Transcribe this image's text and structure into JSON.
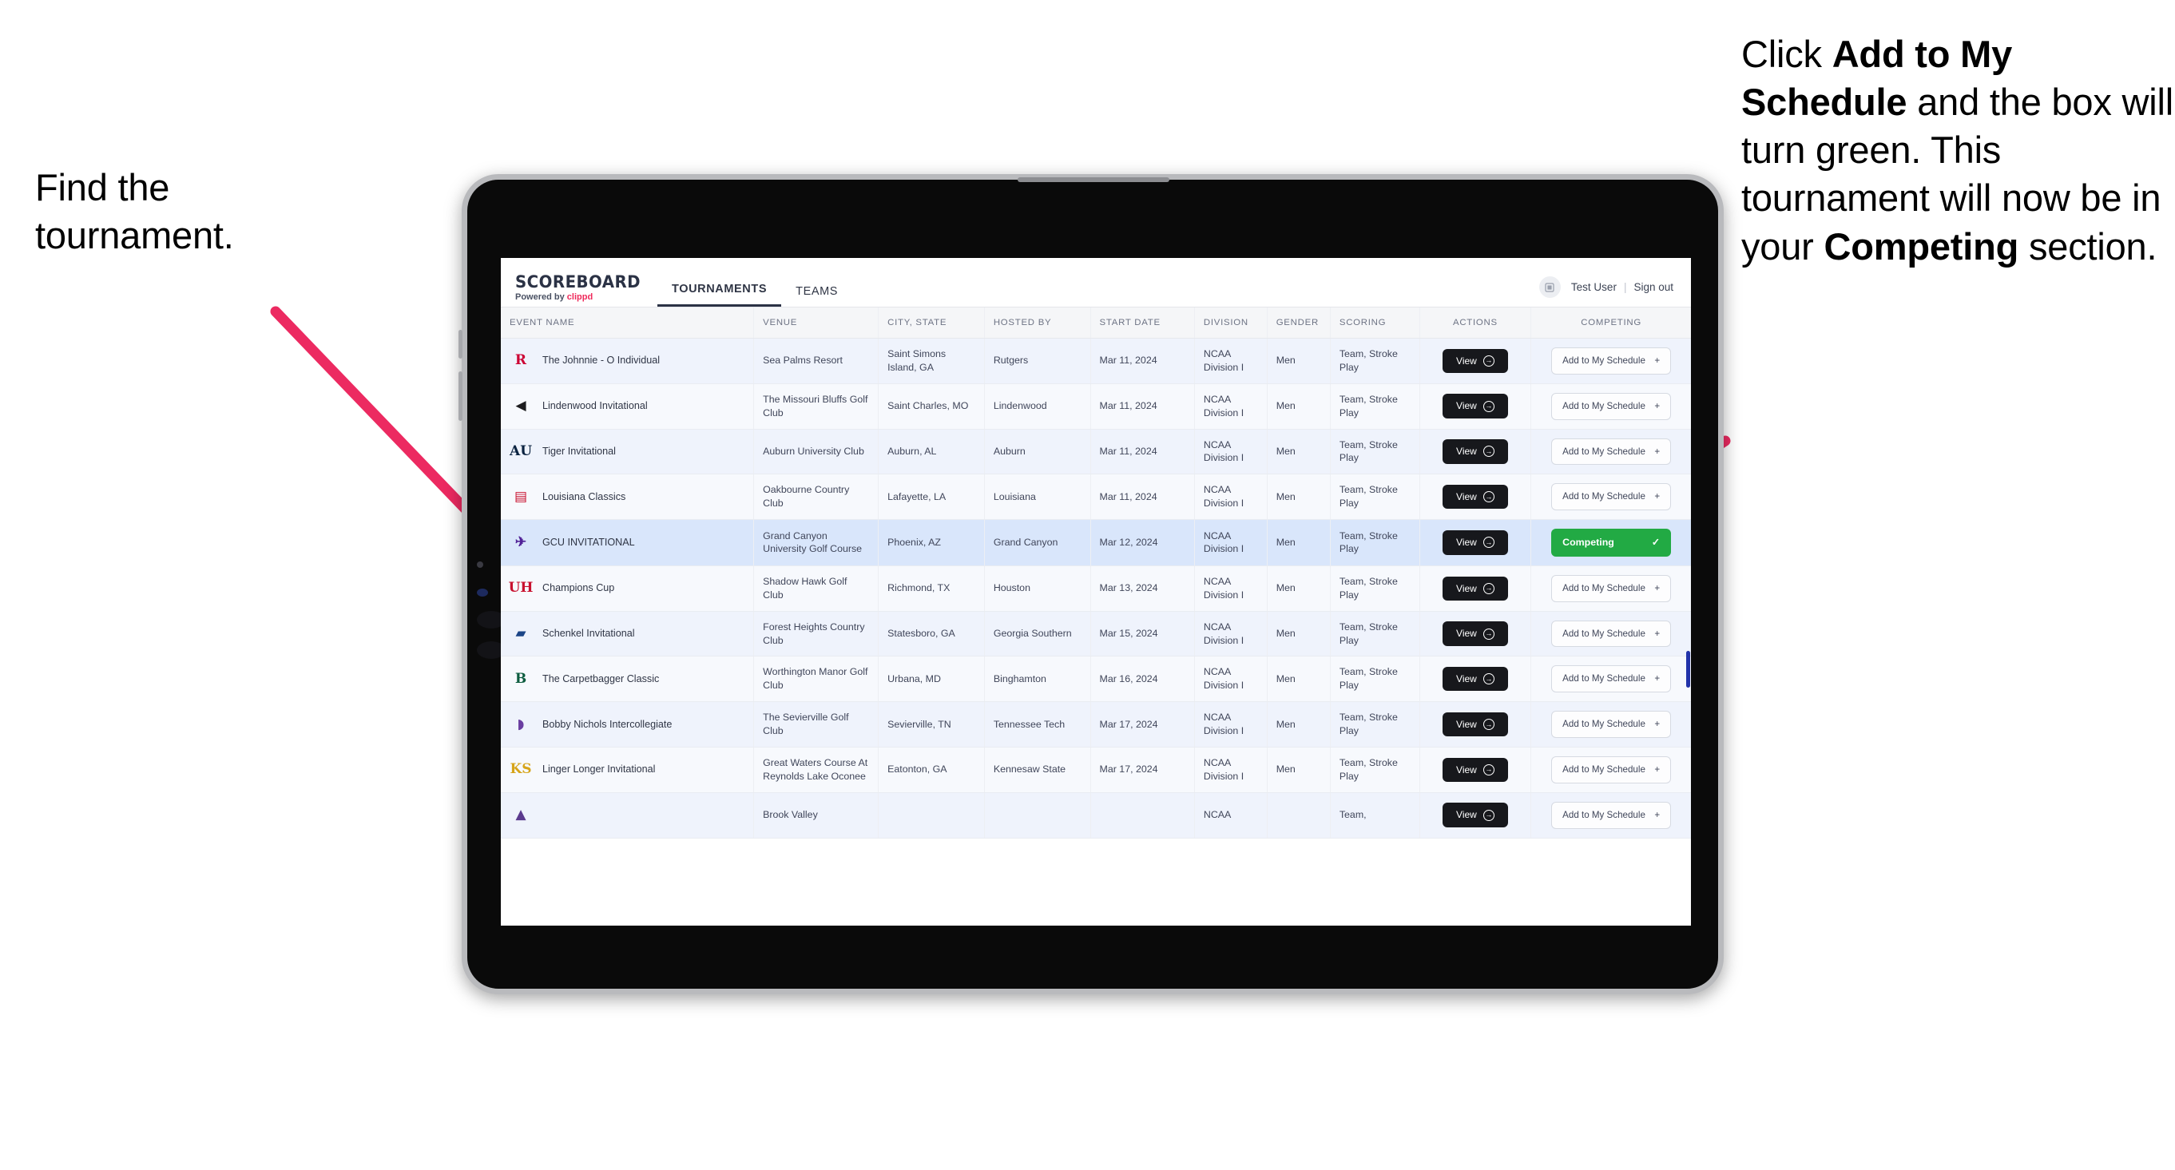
{
  "annotations": {
    "left": "Find the tournament.",
    "right_parts": [
      {
        "t": "Click ",
        "b": false
      },
      {
        "t": "Add to My Schedule",
        "b": true
      },
      {
        "t": " and the box will turn green. This tournament will now be in your ",
        "b": false
      },
      {
        "t": "Competing",
        "b": true
      },
      {
        "t": " section.",
        "b": false
      }
    ],
    "arrow_color": "#ec2a61"
  },
  "app": {
    "logo_main": "SCOREBOARD",
    "logo_sub_prefix": "Powered by ",
    "logo_sub_brand": "clippd",
    "tabs": [
      {
        "label": "TOURNAMENTS",
        "active": true
      },
      {
        "label": "TEAMS",
        "active": false
      }
    ],
    "user": {
      "avatar_icon": "user-avatar-icon",
      "name": "Test User",
      "separator": "|",
      "signout": "Sign out"
    }
  },
  "table": {
    "columns": [
      "EVENT NAME",
      "VENUE",
      "CITY, STATE",
      "HOSTED BY",
      "START DATE",
      "DIVISION",
      "GENDER",
      "SCORING",
      "ACTIONS",
      "COMPETING"
    ],
    "view_label": "View",
    "add_label": "Add to My Schedule",
    "add_glyph": "+",
    "competing_label": "Competing",
    "competing_glyph": "✓",
    "rows": [
      {
        "event": "The Johnnie - O Individual",
        "venue": "Sea Palms Resort",
        "city": "Saint Simons Island, GA",
        "host": "Rutgers",
        "date": "Mar 11, 2024",
        "division": "NCAA Division I",
        "gender": "Men",
        "scoring": "Team, Stroke Play",
        "competing": false,
        "logo": {
          "glyph": "R",
          "color": "#cc0033"
        }
      },
      {
        "event": "Lindenwood Invitational",
        "venue": "The Missouri Bluffs Golf Club",
        "city": "Saint Charles, MO",
        "host": "Lindenwood",
        "date": "Mar 11, 2024",
        "division": "NCAA Division I",
        "gender": "Men",
        "scoring": "Team, Stroke Play",
        "competing": false,
        "logo": {
          "glyph": "◀",
          "color": "#1d1d1f"
        }
      },
      {
        "event": "Tiger Invitational",
        "venue": "Auburn University Club",
        "city": "Auburn, AL",
        "host": "Auburn",
        "date": "Mar 11, 2024",
        "division": "NCAA Division I",
        "gender": "Men",
        "scoring": "Team, Stroke Play",
        "competing": false,
        "logo": {
          "glyph": "AU",
          "color": "#0b2341"
        }
      },
      {
        "event": "Louisiana Classics",
        "venue": "Oakbourne Country Club",
        "city": "Lafayette, LA",
        "host": "Louisiana",
        "date": "Mar 11, 2024",
        "division": "NCAA Division I",
        "gender": "Men",
        "scoring": "Team, Stroke Play",
        "competing": false,
        "logo": {
          "glyph": "▤",
          "color": "#c8102e"
        }
      },
      {
        "event": "GCU INVITATIONAL",
        "venue": "Grand Canyon University Golf Course",
        "city": "Phoenix, AZ",
        "host": "Grand Canyon",
        "date": "Mar 12, 2024",
        "division": "NCAA Division I",
        "gender": "Men",
        "scoring": "Team, Stroke Play",
        "competing": true,
        "logo": {
          "glyph": "✈",
          "color": "#522398"
        }
      },
      {
        "event": "Champions Cup",
        "venue": "Shadow Hawk Golf Club",
        "city": "Richmond, TX",
        "host": "Houston",
        "date": "Mar 13, 2024",
        "division": "NCAA Division I",
        "gender": "Men",
        "scoring": "Team, Stroke Play",
        "competing": false,
        "logo": {
          "glyph": "UH",
          "color": "#c8102e"
        }
      },
      {
        "event": "Schenkel Invitational",
        "venue": "Forest Heights Country Club",
        "city": "Statesboro, GA",
        "host": "Georgia Southern",
        "date": "Mar 15, 2024",
        "division": "NCAA Division I",
        "gender": "Men",
        "scoring": "Team, Stroke Play",
        "competing": false,
        "logo": {
          "glyph": "▰",
          "color": "#1c4587"
        }
      },
      {
        "event": "The Carpetbagger Classic",
        "venue": "Worthington Manor Golf Club",
        "city": "Urbana, MD",
        "host": "Binghamton",
        "date": "Mar 16, 2024",
        "division": "NCAA Division I",
        "gender": "Men",
        "scoring": "Team, Stroke Play",
        "competing": false,
        "logo": {
          "glyph": "B",
          "color": "#0d5c3f"
        }
      },
      {
        "event": "Bobby Nichols Intercollegiate",
        "venue": "The Sevierville Golf Club",
        "city": "Sevierville, TN",
        "host": "Tennessee Tech",
        "date": "Mar 17, 2024",
        "division": "NCAA Division I",
        "gender": "Men",
        "scoring": "Team, Stroke Play",
        "competing": false,
        "logo": {
          "glyph": "◗",
          "color": "#6a3ea1"
        }
      },
      {
        "event": "Linger Longer Invitational",
        "venue": "Great Waters Course At Reynolds Lake Oconee",
        "city": "Eatonton, GA",
        "host": "Kennesaw State",
        "date": "Mar 17, 2024",
        "division": "NCAA Division I",
        "gender": "Men",
        "scoring": "Team, Stroke Play",
        "competing": false,
        "logo": {
          "glyph": "KS",
          "color": "#d6a419"
        }
      },
      {
        "event": "",
        "venue": "Brook Valley",
        "city": "",
        "host": "",
        "date": "",
        "division": "NCAA",
        "gender": "",
        "scoring": "Team,",
        "competing": false,
        "logo": {
          "glyph": "▲",
          "color": "#5b3a8e"
        }
      }
    ]
  }
}
